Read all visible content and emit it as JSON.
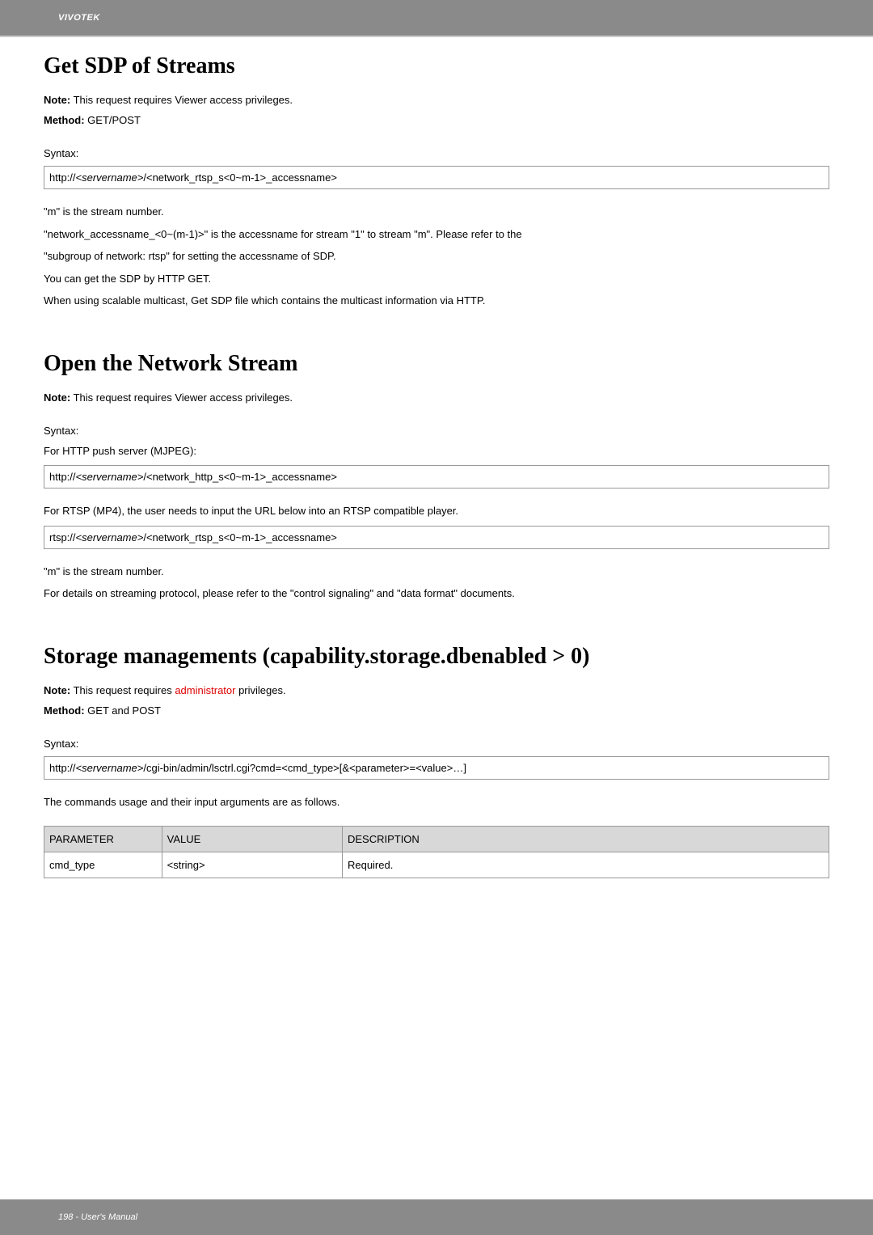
{
  "header": {
    "brand": "VIVOTEK"
  },
  "section1": {
    "title": "Get SDP of Streams",
    "note_label": "Note:",
    "note_text": " This request requires Viewer access privileges.",
    "method_label": "Method:",
    "method_text": " GET/POST",
    "syntax_label": "Syntax:",
    "syntax_prefix": "http://",
    "syntax_server": "<servername>",
    "syntax_suffix": "/<network_rtsp_s<0~m-1>_accessname>",
    "body1": "\"m\" is the stream number.",
    "body2": "\"network_accessname_<0~(m-1)>\" is the accessname for stream \"1\" to stream \"m\". Please refer to the",
    "body3": "\"subgroup of network: rtsp\" for setting the accessname of SDP.",
    "body4": "You can get the SDP by HTTP GET.",
    "body5": "When using scalable multicast, Get SDP file which contains the multicast information via HTTP."
  },
  "section2": {
    "title": "Open the Network Stream",
    "note_label": "Note:",
    "note_text": " This request requires Viewer access privileges.",
    "syntax_label": "Syntax:",
    "http_label": "For HTTP push server (MJPEG):",
    "http_prefix": "http://",
    "http_server": "<servername>",
    "http_suffix": "/<network_http_s<0~m-1>_accessname>",
    "rtsp_label": "For RTSP (MP4), the user needs to input the URL below into an RTSP compatible player.",
    "rtsp_prefix": "rtsp://",
    "rtsp_server": "<servername>",
    "rtsp_suffix": "/<network_rtsp_s<0~m-1>_accessname>",
    "body1": "\"m\" is the stream number.",
    "body2": "For details on streaming protocol, please refer to the \"control signaling\" and \"data format\" documents."
  },
  "section3": {
    "title": "Storage managements (capability.storage.dbenabled > 0)",
    "note_label": "Note:",
    "note_text1": " This request requires ",
    "note_red": "administrator",
    "note_text2": " privileges.",
    "method_label": "Method:",
    "method_text": " GET and POST",
    "syntax_label": "Syntax:",
    "syntax_prefix": "http://",
    "syntax_server": "<servername>",
    "syntax_suffix": "/cgi-bin/admin/lsctrl.cgi?cmd=<cmd_type>[&<parameter>=<value>…]",
    "body1": "The commands usage and their input arguments are as follows.",
    "table": {
      "header": {
        "param": "PARAMETER",
        "value": "VALUE",
        "desc": "DESCRIPTION"
      },
      "rows": [
        {
          "param": "cmd_type",
          "value": "<string>",
          "desc": "Required."
        }
      ]
    }
  },
  "footer": {
    "text": "198 - User's Manual"
  }
}
